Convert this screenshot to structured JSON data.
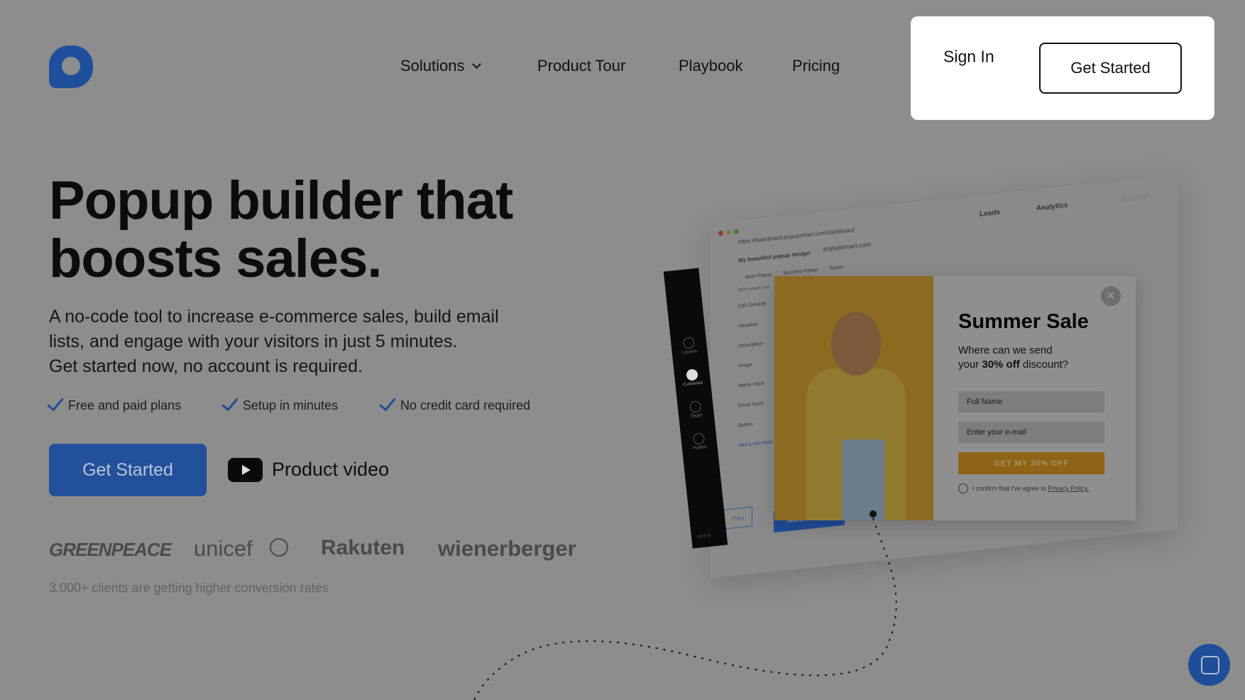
{
  "nav": {
    "solutions": "Solutions",
    "product_tour": "Product Tour",
    "playbook": "Playbook",
    "pricing": "Pricing",
    "sign_in": "Sign In",
    "get_started": "Get Started"
  },
  "hero": {
    "title_line1": "Popup builder that",
    "title_line2": "boosts sales.",
    "para_line1": "A no-code tool to increase e-commerce sales, build email",
    "para_line2": "lists, and engage with your visitors in just 5 minutes.",
    "para_line3": "Get started now, no account is required.",
    "checks": [
      "Free and paid plans",
      "Setup in minutes",
      "No credit card required"
    ],
    "cta": "Get Started",
    "video": "Product video",
    "brands": [
      "GREENPEACE",
      "unicef",
      "Rakuten",
      "wienerberger"
    ],
    "caption": "3.000+ clients are getting higher conversion rates"
  },
  "mockup": {
    "url": "https://dashboard.popupsmart.com/dashboard",
    "leads": "Leads",
    "analytics": "Analytics",
    "account": "Account",
    "design_name": "My beautiful popup design",
    "site": "popupsmart.com",
    "tabs": [
      "Main Popup",
      "Success Popup",
      "Teaser"
    ],
    "edit_content": "Edit content and",
    "edit_general": "Edit General",
    "fields": [
      "Headline",
      "Description",
      "Image",
      "Name Input",
      "Email Input",
      "Button"
    ],
    "add_new": "Add a new field",
    "steps": [
      "Layouts",
      "Customize",
      "Target",
      "Publish"
    ],
    "prev": "Prev",
    "next": "Next to customize",
    "version": "v1.5.6",
    "popup": {
      "title": "Summer Sale",
      "q_line1": "Where can we send",
      "q_pre": "your ",
      "q_bold": "30% off",
      "q_post": " discount?",
      "name_ph": "Full Name",
      "email_ph": "Enter your e-mail",
      "button": "GET MY 30% OFF",
      "consent": "I confirm that I've agree to ",
      "privacy": "Privacy Policy."
    }
  },
  "colors": {
    "brand_blue": "#1f4f9c",
    "overlay_bg": "#8d8d8d",
    "popup_button": "#8f6418"
  }
}
